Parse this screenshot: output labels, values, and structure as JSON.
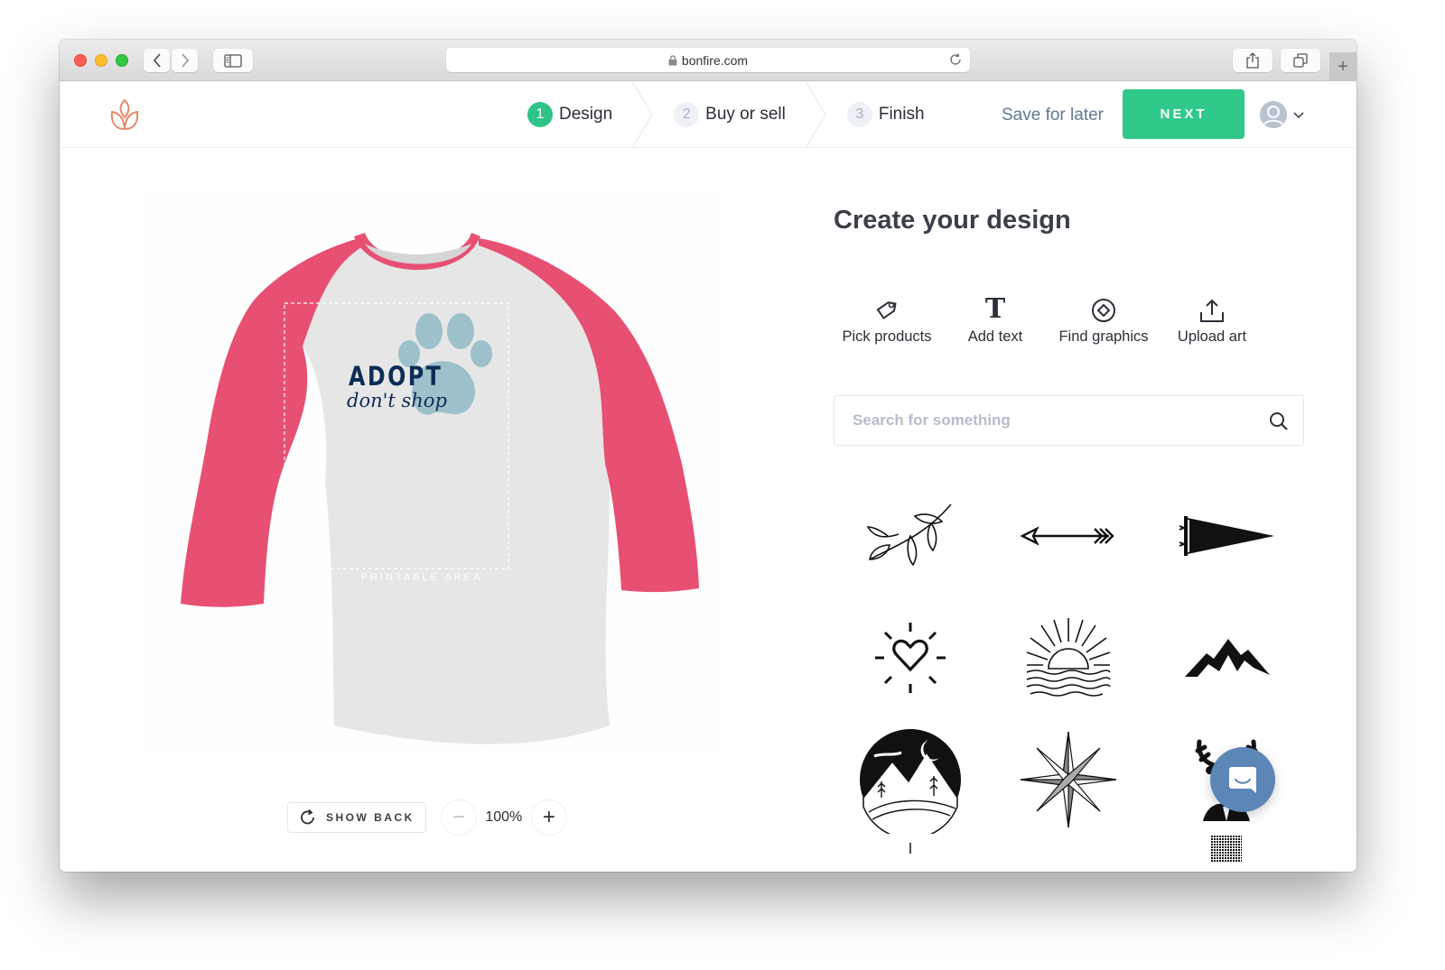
{
  "browser": {
    "url": "bonfire.com",
    "lock_icon": "lock-icon",
    "buttons": [
      "back",
      "forward",
      "sidebar",
      "reload",
      "share",
      "tabs",
      "new-tab"
    ]
  },
  "header": {
    "logo": "bonfire-flame-logo",
    "steps": [
      {
        "number": "1",
        "label": "Design",
        "active": true
      },
      {
        "number": "2",
        "label": "Buy or sell",
        "active": false
      },
      {
        "number": "3",
        "label": "Finish",
        "active": false
      }
    ],
    "save_label": "Save for later",
    "next_label": "NEXT",
    "accent_color": "#30c98a"
  },
  "canvas": {
    "product": "Raglan 3/4 sleeve tee",
    "sleeve_color": "#e84f72",
    "body_color": "#e6e6e6",
    "printable_area_label": "PRINTABLE AREA",
    "design": {
      "line1": "ADOPT",
      "line2": "don't shop",
      "graphic": "paw-print"
    },
    "show_back_label": "SHOW BACK",
    "zoom_value": "100%"
  },
  "panel": {
    "title": "Create your design",
    "tools": [
      {
        "label": "Pick products",
        "icon": "tag-icon"
      },
      {
        "label": "Add text",
        "icon": "text-icon"
      },
      {
        "label": "Find graphics",
        "icon": "graphics-icon"
      },
      {
        "label": "Upload art",
        "icon": "upload-icon"
      }
    ],
    "search_placeholder": "Search for something",
    "graphics": [
      "leaf-branch",
      "arrow",
      "pennant",
      "heart-sun",
      "sunset-waves",
      "mountains",
      "moon-mountains-circle",
      "compass-star",
      "deer-head"
    ]
  },
  "chat": {
    "icon": "chat-icon"
  }
}
